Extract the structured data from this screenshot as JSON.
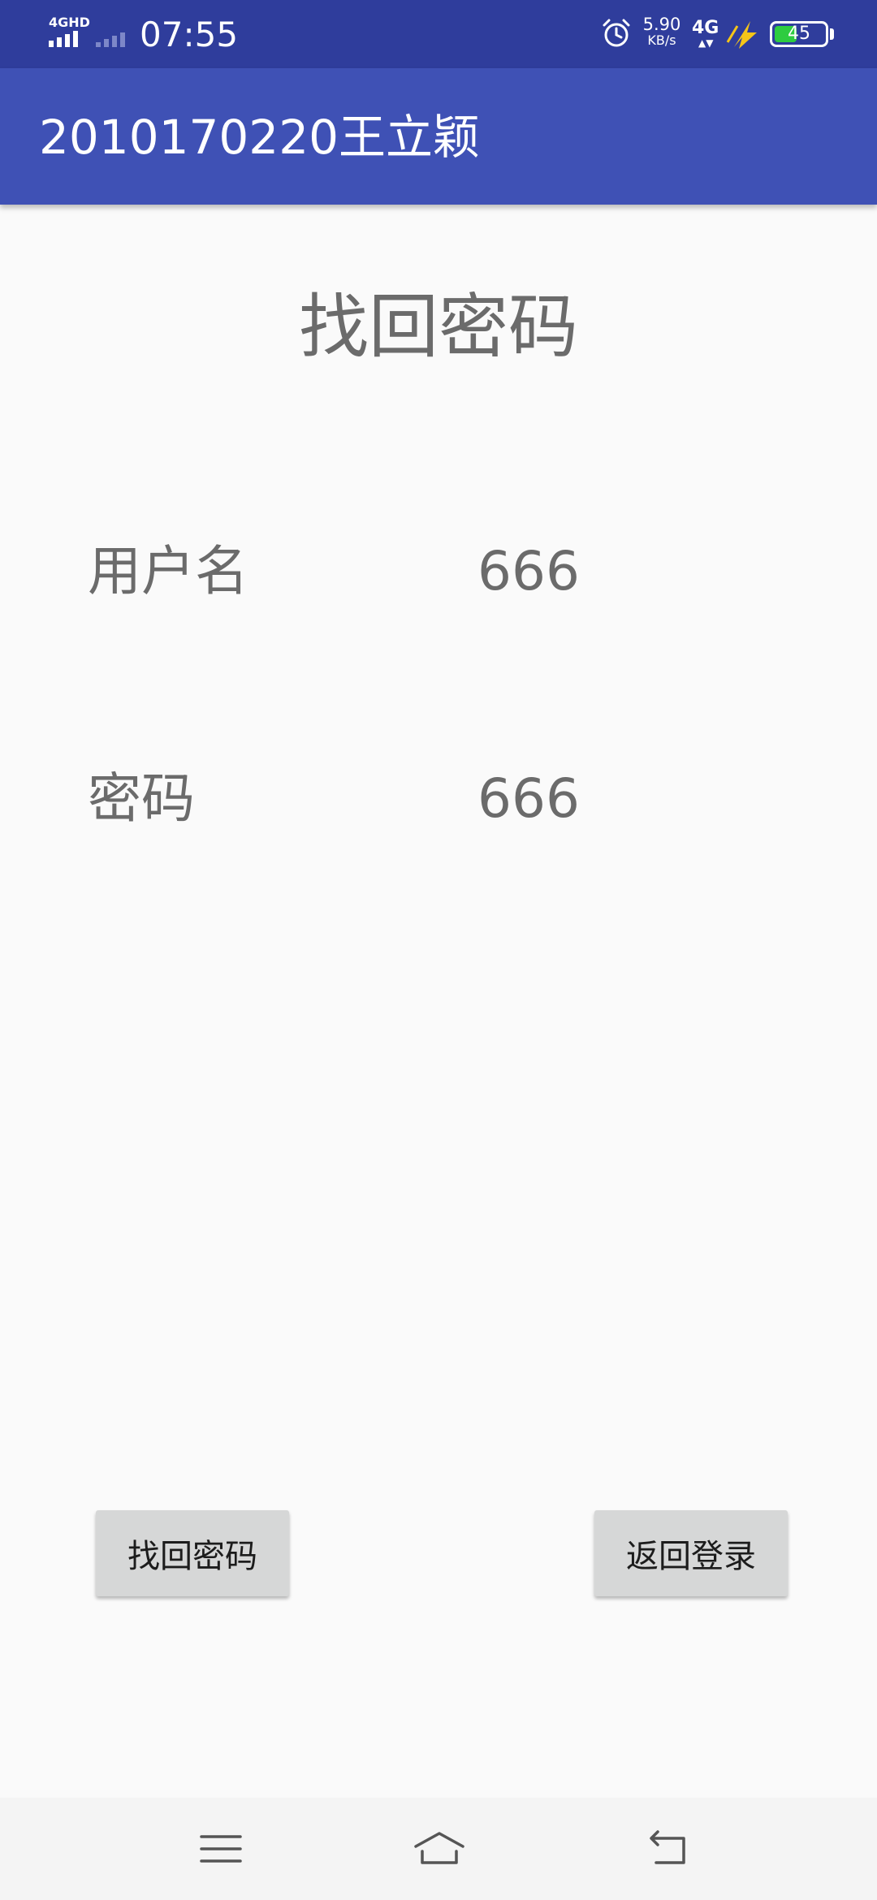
{
  "status_bar": {
    "network_label": "4GHD",
    "time": "07:55",
    "speed_value": "5.90",
    "speed_unit": "KB/s",
    "data_network": "4G",
    "battery_level": "45",
    "battery_fraction": 0.45,
    "battery_color": "#2ecc40",
    "icons": [
      "signal-icon",
      "alarm-icon",
      "charging-icon",
      "battery-icon"
    ]
  },
  "app_bar": {
    "title": "2010170220王立颖",
    "color": "#3f51b5"
  },
  "page": {
    "heading": "找回密码",
    "username_label": "用户名",
    "username_value": "666",
    "password_label": "密码",
    "password_value": "666"
  },
  "buttons": {
    "find_password": "找回密码",
    "back_to_login": "返回登录"
  },
  "nav_bar": {
    "icons": [
      "menu-icon",
      "home-icon",
      "back-icon"
    ]
  }
}
